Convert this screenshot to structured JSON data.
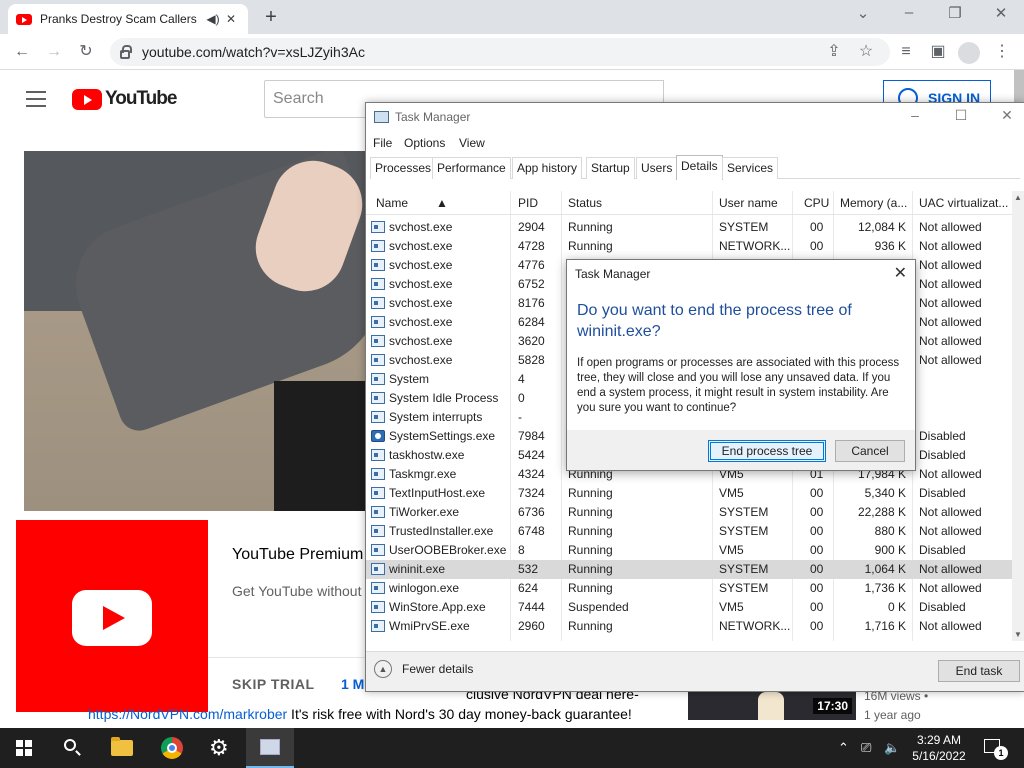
{
  "browser": {
    "tab_title": "Pranks Destroy Scam Callers",
    "url": "youtube.com/watch?v=xsLJZyih3Ac"
  },
  "youtube": {
    "logo_text": "YouTube",
    "search_placeholder": "Search",
    "sign_in": "SIGN IN",
    "premium_title": "YouTube Premium",
    "premium_sub": "Get YouTube without",
    "skip_trial": "SKIP TRIAL",
    "one_month": "1 M",
    "desc_line1": "clusive NordVPN deal here-",
    "desc_link": "https://NordVPN.com/markrober",
    "desc_line2": " It's risk free with Nord's 30 day money-back guarantee!",
    "rec_duration": "17:30",
    "rec_views": "16M views •",
    "rec_age": "1 year ago"
  },
  "task_manager": {
    "title": "Task Manager",
    "menu": [
      "File",
      "Options",
      "View"
    ],
    "tabs": [
      "Processes",
      "Performance",
      "App history",
      "Startup",
      "Users",
      "Details",
      "Services"
    ],
    "active_tab": "Details",
    "columns": [
      "Name",
      "PID",
      "Status",
      "User name",
      "CPU",
      "Memory (a...",
      "UAC virtualizat..."
    ],
    "rows": [
      {
        "name": "svchost.exe",
        "pid": "2904",
        "status": "Running",
        "user": "SYSTEM",
        "cpu": "00",
        "mem": "12,084 K",
        "uac": "Not allowed"
      },
      {
        "name": "svchost.exe",
        "pid": "4728",
        "status": "Running",
        "user": "NETWORK...",
        "cpu": "00",
        "mem": "936 K",
        "uac": "Not allowed"
      },
      {
        "name": "svchost.exe",
        "pid": "4776",
        "status": "",
        "user": "",
        "cpu": "",
        "mem": "",
        "uac": "Not allowed"
      },
      {
        "name": "svchost.exe",
        "pid": "6752",
        "status": "",
        "user": "",
        "cpu": "",
        "mem": "",
        "uac": "Not allowed"
      },
      {
        "name": "svchost.exe",
        "pid": "8176",
        "status": "",
        "user": "",
        "cpu": "",
        "mem": "",
        "uac": "Not allowed"
      },
      {
        "name": "svchost.exe",
        "pid": "6284",
        "status": "",
        "user": "",
        "cpu": "",
        "mem": "",
        "uac": "Not allowed"
      },
      {
        "name": "svchost.exe",
        "pid": "3620",
        "status": "",
        "user": "",
        "cpu": "",
        "mem": "",
        "uac": "Not allowed"
      },
      {
        "name": "svchost.exe",
        "pid": "5828",
        "status": "",
        "user": "",
        "cpu": "",
        "mem": "",
        "uac": "Not allowed"
      },
      {
        "name": "System",
        "pid": "4",
        "status": "",
        "user": "",
        "cpu": "",
        "mem": "",
        "uac": ""
      },
      {
        "name": "System Idle Process",
        "pid": "0",
        "status": "",
        "user": "",
        "cpu": "",
        "mem": "",
        "uac": ""
      },
      {
        "name": "System interrupts",
        "pid": "-",
        "status": "",
        "user": "",
        "cpu": "",
        "mem": "",
        "uac": ""
      },
      {
        "name": "SystemSettings.exe",
        "pid": "7984",
        "status": "",
        "user": "",
        "cpu": "",
        "mem": "",
        "uac": "Disabled",
        "icon": "gear"
      },
      {
        "name": "taskhostw.exe",
        "pid": "5424",
        "status": "",
        "user": "",
        "cpu": "",
        "mem": "",
        "uac": "Disabled"
      },
      {
        "name": "Taskmgr.exe",
        "pid": "4324",
        "status": "Running",
        "user": "VM5",
        "cpu": "01",
        "mem": "17,984 K",
        "uac": "Not allowed"
      },
      {
        "name": "TextInputHost.exe",
        "pid": "7324",
        "status": "Running",
        "user": "VM5",
        "cpu": "00",
        "mem": "5,340 K",
        "uac": "Disabled"
      },
      {
        "name": "TiWorker.exe",
        "pid": "6736",
        "status": "Running",
        "user": "SYSTEM",
        "cpu": "00",
        "mem": "22,288 K",
        "uac": "Not allowed"
      },
      {
        "name": "TrustedInstaller.exe",
        "pid": "6748",
        "status": "Running",
        "user": "SYSTEM",
        "cpu": "00",
        "mem": "880 K",
        "uac": "Not allowed"
      },
      {
        "name": "UserOOBEBroker.exe",
        "pid": "8",
        "status": "Running",
        "user": "VM5",
        "cpu": "00",
        "mem": "900 K",
        "uac": "Disabled"
      },
      {
        "name": "wininit.exe",
        "pid": "532",
        "status": "Running",
        "user": "SYSTEM",
        "cpu": "00",
        "mem": "1,064 K",
        "uac": "Not allowed",
        "selected": true
      },
      {
        "name": "winlogon.exe",
        "pid": "624",
        "status": "Running",
        "user": "SYSTEM",
        "cpu": "00",
        "mem": "1,736 K",
        "uac": "Not allowed"
      },
      {
        "name": "WinStore.App.exe",
        "pid": "7444",
        "status": "Suspended",
        "user": "VM5",
        "cpu": "00",
        "mem": "0 K",
        "uac": "Disabled"
      },
      {
        "name": "WmiPrvSE.exe",
        "pid": "2960",
        "status": "Running",
        "user": "NETWORK...",
        "cpu": "00",
        "mem": "1,716 K",
        "uac": "Not allowed"
      }
    ],
    "fewer_details": "Fewer details",
    "end_task": "End task"
  },
  "dialog": {
    "title": "Task Manager",
    "question": "Do you want to end the process tree of wininit.exe?",
    "message": "If open programs or processes are associated with this process tree, they will close and you will lose any unsaved data. If you end a system process, it might result in system instability. Are you sure you want to continue?",
    "confirm": "End process tree",
    "cancel": "Cancel"
  },
  "taskbar": {
    "time": "3:29 AM",
    "date": "5/16/2022",
    "notification_count": "1"
  }
}
